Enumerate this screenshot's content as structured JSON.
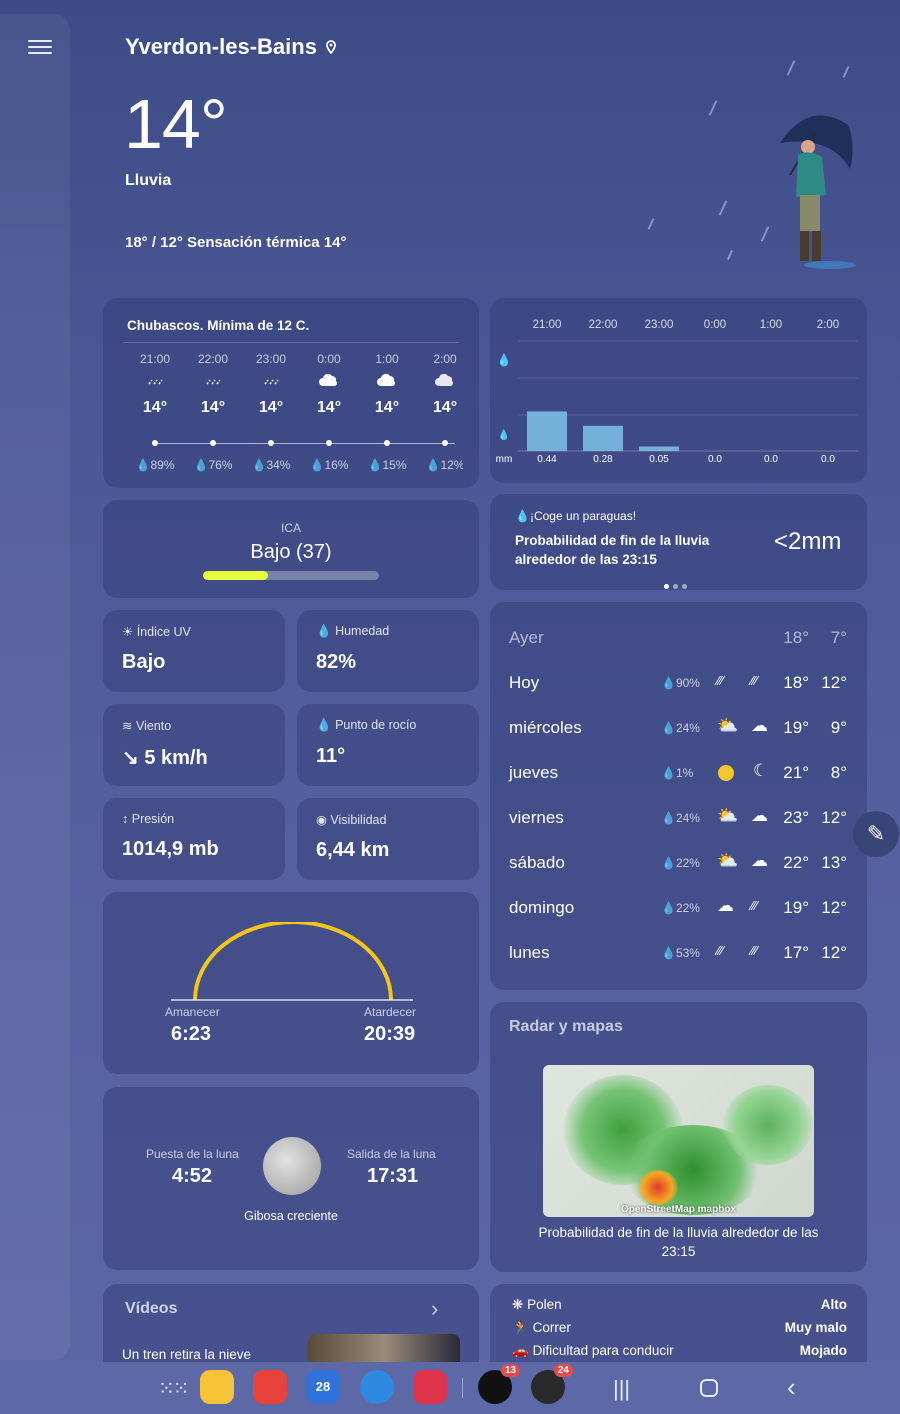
{
  "header": {
    "location": "Yverdon-les-Bains",
    "temp": "14°",
    "condition": "Lluvia",
    "range_feels": "18° / 12° Sensación térmica 14°"
  },
  "hourly": {
    "summary": "Chubascos. Mínima de 12 C.",
    "items": [
      {
        "time": "21:00",
        "temp": "14°",
        "precip": "89%",
        "icon": "rain-icon"
      },
      {
        "time": "22:00",
        "temp": "14°",
        "precip": "76%",
        "icon": "rain-icon"
      },
      {
        "time": "23:00",
        "temp": "14°",
        "precip": "34%",
        "icon": "rain-icon"
      },
      {
        "time": "0:00",
        "temp": "14°",
        "precip": "16%",
        "icon": "cloud-icon"
      },
      {
        "time": "1:00",
        "temp": "14°",
        "precip": "15%",
        "icon": "cloud-icon"
      },
      {
        "time": "2:00",
        "temp": "14°",
        "precip": "12%",
        "icon": "cloud-icon"
      }
    ]
  },
  "precip_chart": {
    "times": [
      "21:00",
      "22:00",
      "23:00",
      "0:00",
      "1:00",
      "2:00"
    ],
    "unit": "mm",
    "values": [
      0.44,
      0.28,
      0.05,
      0.0,
      0.0,
      0.0
    ],
    "labels": [
      "0.44",
      "0.28",
      "0.05",
      "0.0",
      "0.0",
      "0.0"
    ]
  },
  "aqi": {
    "label": "ICA",
    "value": "Bajo (37)",
    "level": 0.37
  },
  "rain_card": {
    "title": "¡Coge un paraguas!",
    "text": "Probabilidad de fin de la lluvia alrededor de las 23:15",
    "amount": "<2mm"
  },
  "tiles": {
    "uv": {
      "title": "Índice UV",
      "value": "Bajo"
    },
    "humidity": {
      "title": "Humedad",
      "value": "82%"
    },
    "wind": {
      "title": "Viento",
      "value": "5 km/h"
    },
    "dew": {
      "title": "Punto de rocío",
      "value": "11°"
    },
    "pressure": {
      "title": "Presión",
      "value": "1014,9 mb"
    },
    "visibility": {
      "title": "Visibilidad",
      "value": "6,44 km"
    }
  },
  "daily": [
    {
      "day": "Ayer",
      "precip": "",
      "hi": "18°",
      "lo": "7°"
    },
    {
      "day": "Hoy",
      "precip": "90%",
      "hi": "18°",
      "lo": "12°"
    },
    {
      "day": "miércoles",
      "precip": "24%",
      "hi": "19°",
      "lo": "9°"
    },
    {
      "day": "jueves",
      "precip": "1%",
      "hi": "21°",
      "lo": "8°"
    },
    {
      "day": "viernes",
      "precip": "24%",
      "hi": "23°",
      "lo": "12°"
    },
    {
      "day": "sábado",
      "precip": "22%",
      "hi": "22°",
      "lo": "13°"
    },
    {
      "day": "domingo",
      "precip": "22%",
      "hi": "19°",
      "lo": "12°"
    },
    {
      "day": "lunes",
      "precip": "53%",
      "hi": "17°",
      "lo": "12°"
    }
  ],
  "sun": {
    "sunrise_label": "Amanecer",
    "sunrise": "6:23",
    "sunset_label": "Atardecer",
    "sunset": "20:39"
  },
  "moon": {
    "set_label": "Puesta de la luna",
    "set": "4:52",
    "rise_label": "Salida de la luna",
    "rise": "17:31",
    "phase": "Gibosa creciente"
  },
  "radar": {
    "title": "Radar y mapas",
    "caption": "Probabilidad de fin de la lluvia alrededor de las 23:15",
    "attribution": "OpenStreetMap  mapbox"
  },
  "videos": {
    "title": "Vídeos",
    "item": "Un tren retira la nieve"
  },
  "lifestyle": [
    {
      "label": "Polen",
      "value": "Alto"
    },
    {
      "label": "Correr",
      "value": "Muy malo"
    },
    {
      "label": "Dificultad para conducir",
      "value": "Mojado"
    }
  ],
  "dock": {
    "badge_tiktok": "13",
    "badge_app": "24",
    "calendar_day": "28"
  }
}
